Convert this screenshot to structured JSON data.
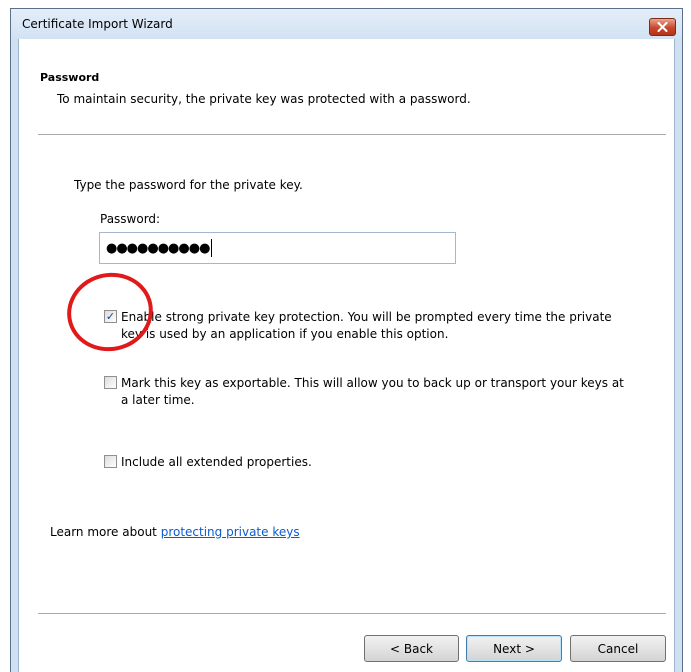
{
  "window": {
    "title": "Certificate Import Wizard"
  },
  "header": {
    "section_title": "Password",
    "description": "To maintain security, the private key was protected with a password."
  },
  "form": {
    "prompt": "Type the password for the private key.",
    "password_label": "Password:",
    "password_value": "●●●●●●●●●●"
  },
  "options": [
    {
      "label": "Enable strong private key protection. You will be prompted every time the private key is used by an application if you enable this option.",
      "checked": true
    },
    {
      "label": "Mark this key as exportable. This will allow you to back up or transport your keys at a later time.",
      "checked": false
    },
    {
      "label": "Include all extended properties.",
      "checked": false
    }
  ],
  "learn_more": {
    "prefix": "Learn more about ",
    "link": "protecting private keys"
  },
  "buttons": {
    "back": "< Back",
    "next": "Next >",
    "cancel": "Cancel"
  },
  "colors": {
    "annotation_circle": "#e01a1a",
    "link": "#0b5ccf",
    "close_button": "#c9472b"
  },
  "icons": {
    "close": "close-icon",
    "check": "checkmark-icon"
  }
}
